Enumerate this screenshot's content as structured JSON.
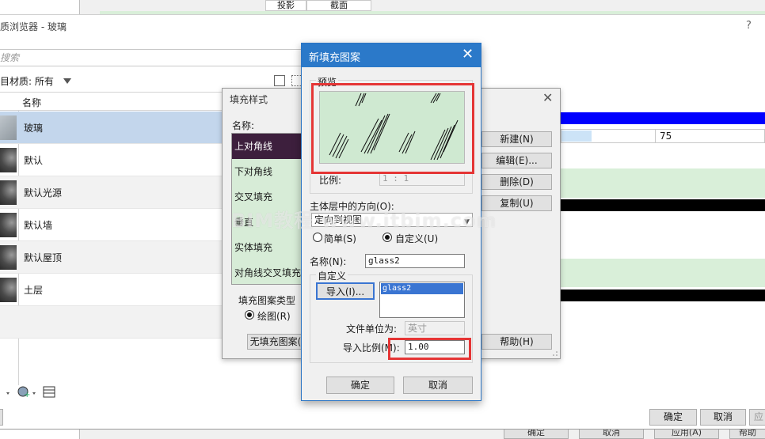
{
  "back_window": {
    "col_headers": [
      "投影",
      "截面"
    ],
    "footer_buttons": [
      "确定",
      "取消",
      "应用(A)",
      "帮助"
    ]
  },
  "material_browser": {
    "title": "质浏览器 - 玻璃",
    "help": "?",
    "search_placeholder": "搜索",
    "filter_label": "目材质: 所有",
    "list_header": "名称",
    "materials": [
      "玻璃",
      "默认",
      "默认光源",
      "默认墙",
      "默认屋顶",
      "土层"
    ],
    "selected_material": "玻璃",
    "buttons": {
      "ok": "确定",
      "cancel": "取消",
      "apply": "应"
    },
    "props_value": "75"
  },
  "fill_style_dialog": {
    "title": "填充样式",
    "name_label": "名称:",
    "patterns": [
      "上对角线",
      "下对角线",
      "交叉填充",
      "垂直",
      "实体填充",
      "对角线交叉填充"
    ],
    "selected_pattern": "上对角线",
    "buttons": [
      "新建(N)",
      "编辑(E)...",
      "删除(D)",
      "复制(U)",
      "帮助(H)"
    ],
    "pattern_type_label": "填充图案类型",
    "pattern_type_option": "绘图(R)",
    "no_fill_button": "无填充图案("
  },
  "new_fill_dialog": {
    "title": "新填充图案",
    "preview_label": "预览",
    "scale_label": "比例:",
    "scale_value": "1 : 1",
    "orientation_label": "主体层中的方向(O):",
    "orientation_value": "定向到视图",
    "simple_option": "简单(S)",
    "custom_option": "自定义(U)",
    "custom_selected": true,
    "name_label": "名称(N):",
    "name_value": "glass2",
    "custom_group_label": "自定义",
    "import_button": "导入(I)...",
    "imported_pattern": "glass2",
    "file_units_label": "文件单位为:",
    "file_units_value": "英寸",
    "import_scale_label": "导入比例(M):",
    "import_scale_value": "1.00",
    "ok_button": "确定",
    "cancel_button": "取消",
    "close_icon": "close-icon"
  },
  "watermark": "BIM教程  www.itbim.com",
  "colors": {
    "title_bar": "#2b79c9",
    "preview_bg": "#cfe9d1",
    "selected_material_row": "#c3d6ec",
    "selected_pattern_row": "#3d1f3d",
    "highlight_box": "#e53535",
    "strip_blue": "#0000ff"
  }
}
